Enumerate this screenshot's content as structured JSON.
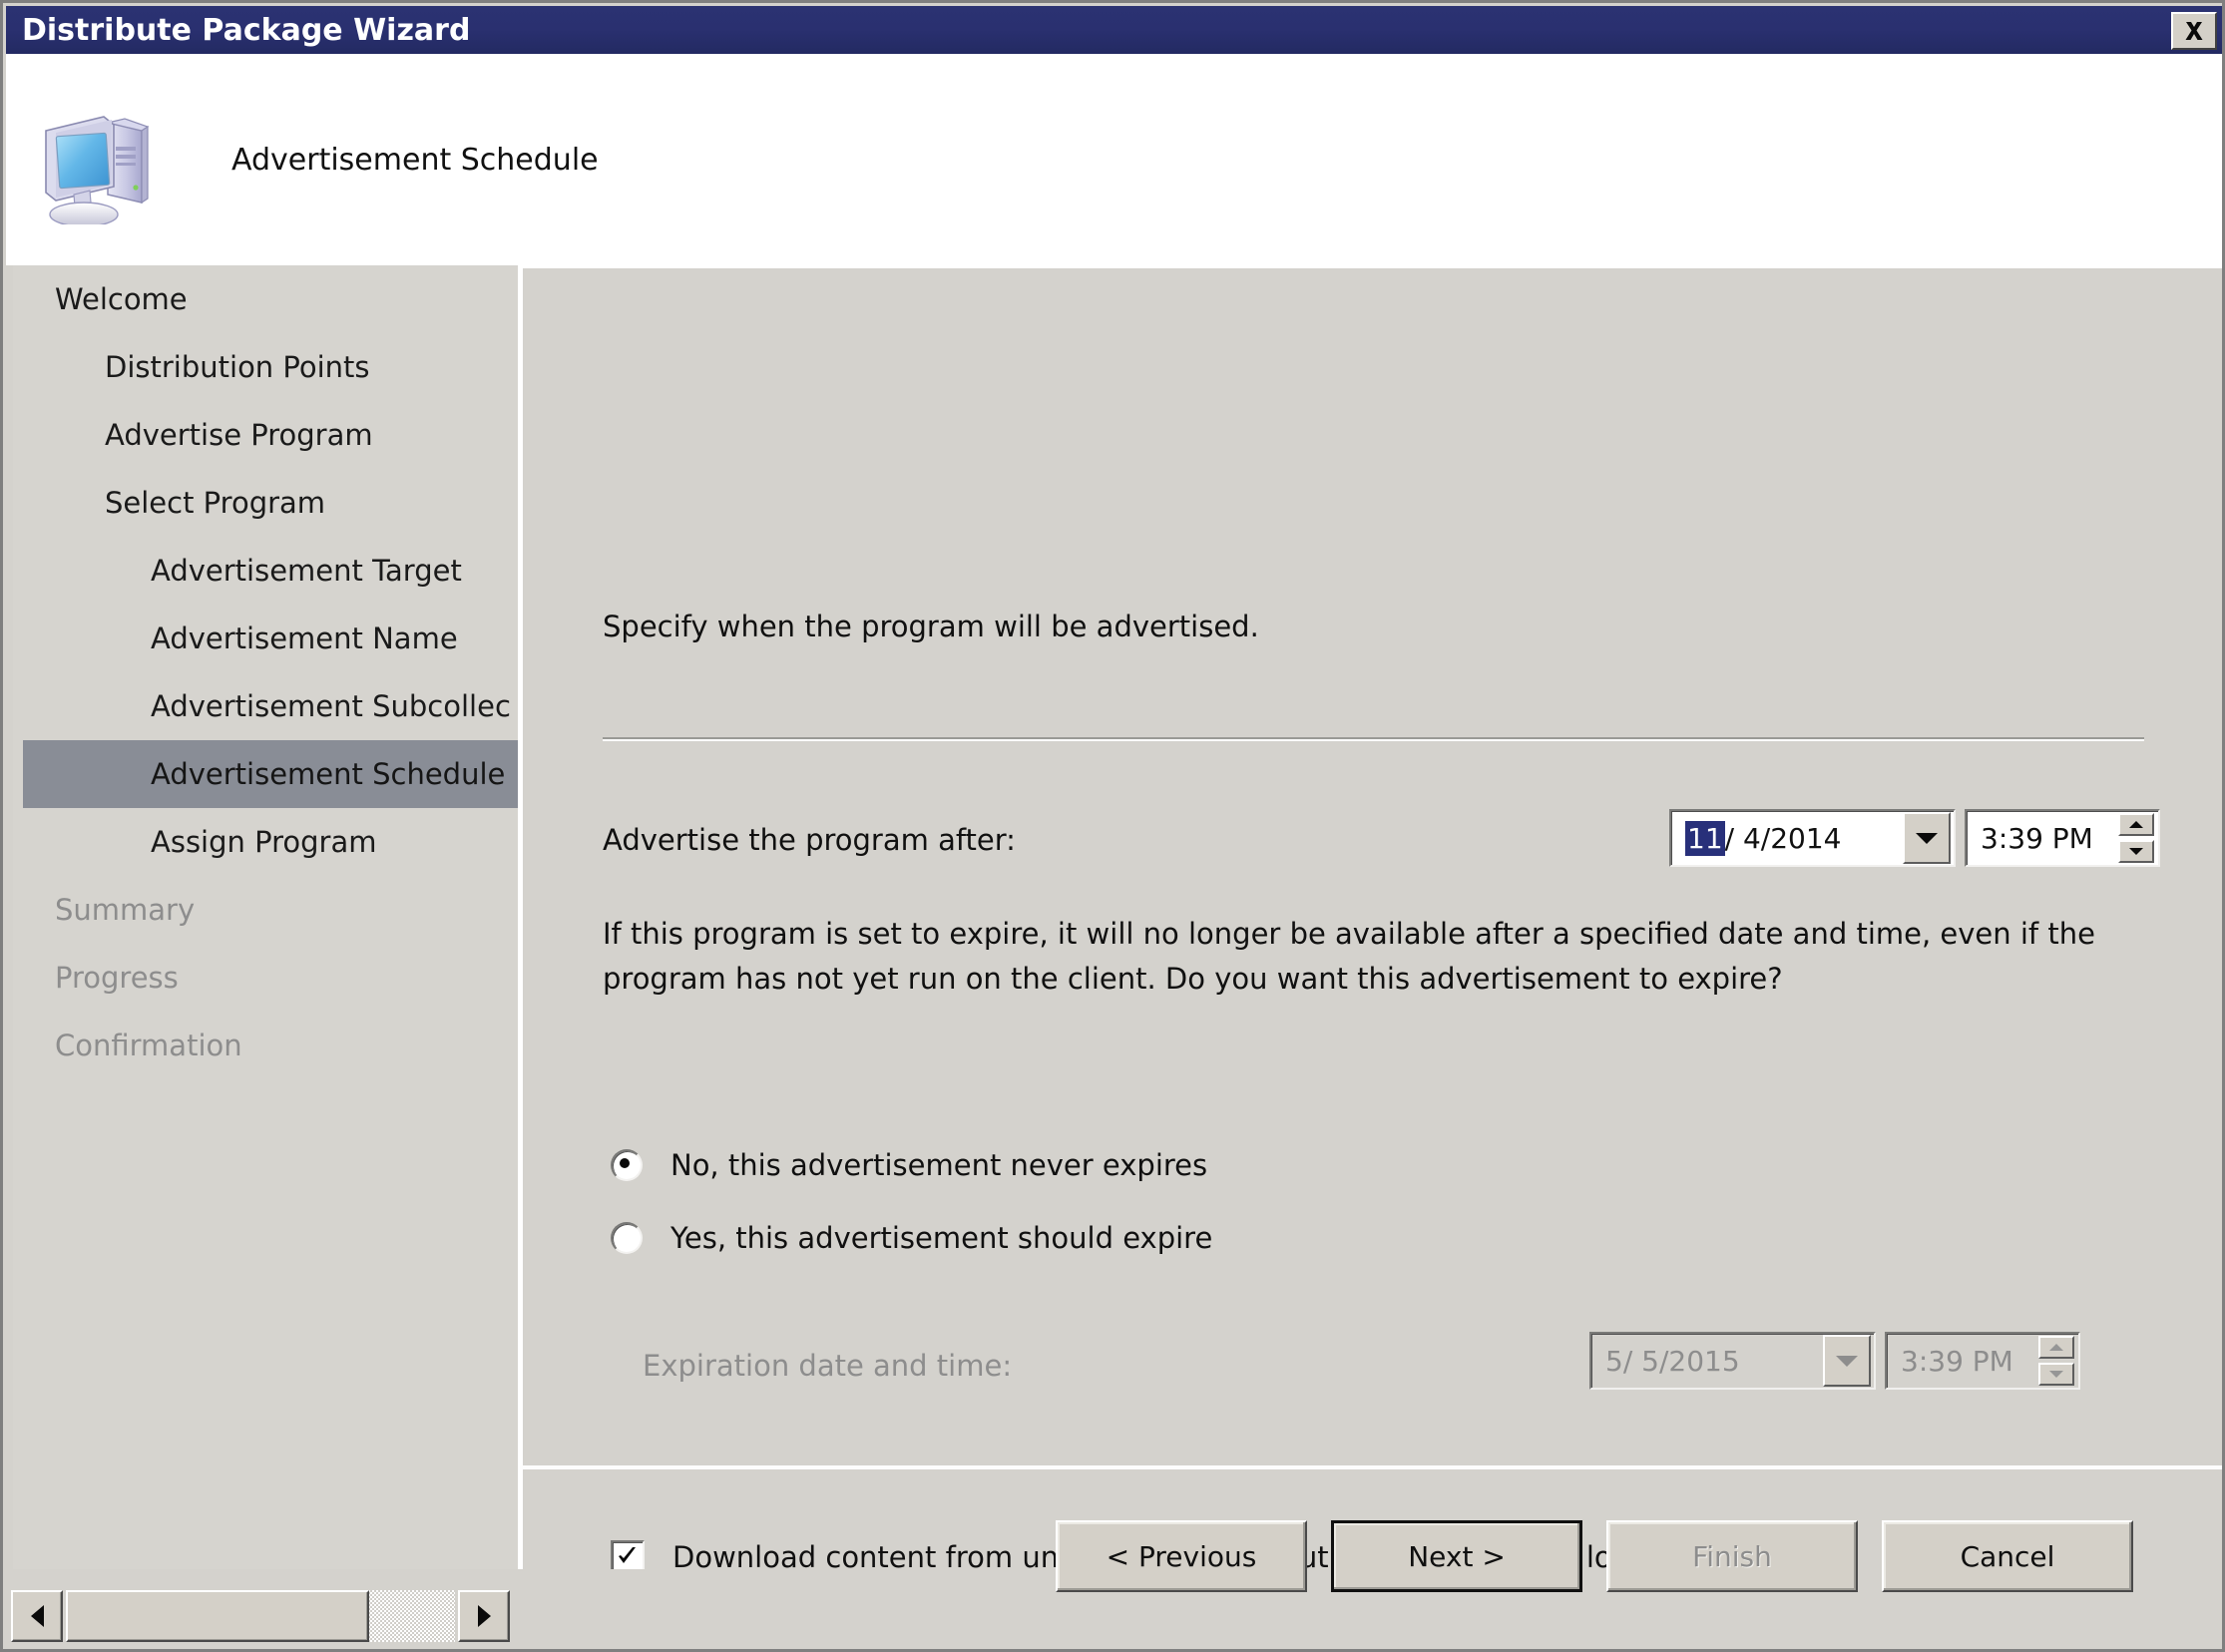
{
  "window": {
    "title": "Distribute Package Wizard",
    "close_icon": "close-x-icon"
  },
  "header": {
    "title": "Advertisement Schedule",
    "icon": "computer-icon"
  },
  "sidebar": {
    "items": [
      {
        "label": "Welcome",
        "level": 0,
        "selected": false,
        "disabled": false
      },
      {
        "label": "Distribution Points",
        "level": 1,
        "selected": false,
        "disabled": false
      },
      {
        "label": "Advertise Program",
        "level": 1,
        "selected": false,
        "disabled": false
      },
      {
        "label": "Select Program",
        "level": 1,
        "selected": false,
        "disabled": false
      },
      {
        "label": "Advertisement Target",
        "level": 2,
        "selected": false,
        "disabled": false
      },
      {
        "label": "Advertisement Name",
        "level": 2,
        "selected": false,
        "disabled": false
      },
      {
        "label": "Advertisement Subcollec",
        "level": 2,
        "selected": false,
        "disabled": false
      },
      {
        "label": "Advertisement Schedule",
        "level": 2,
        "selected": true,
        "disabled": false
      },
      {
        "label": "Assign Program",
        "level": 2,
        "selected": false,
        "disabled": false
      },
      {
        "label": "Summary",
        "level": 0,
        "selected": false,
        "disabled": true
      },
      {
        "label": "Progress",
        "level": 0,
        "selected": false,
        "disabled": true
      },
      {
        "label": "Confirmation",
        "level": 0,
        "selected": false,
        "disabled": true
      }
    ]
  },
  "content": {
    "intro": "Specify when the program will be advertised.",
    "advertise_after_label": "Advertise the program after:",
    "advertise_after_date_selected": "11",
    "advertise_after_date_rest": "/  4/2014",
    "advertise_after_time": "3:39 PM",
    "expire_paragraph": "If this program is set to expire, it will no longer be available after a specified date and time, even if the program has not yet run on the client. Do you want this advertisement to expire?",
    "radio_no_label": "No, this advertisement never expires",
    "radio_yes_label": "Yes, this advertisement should expire",
    "expiration_label": "Expiration date and time:",
    "expiration_date": "5/  5/2015",
    "expiration_time": "3:39 PM",
    "download_checkbox_label": "Download content from unprotected distribution point and run locally",
    "download_checkbox_checked": true,
    "radio_no_selected": true,
    "radio_yes_selected": false
  },
  "footer": {
    "previous_label": "< Previous",
    "next_label": "Next >",
    "finish_label": "Finish",
    "cancel_label": "Cancel"
  },
  "colors": {
    "titlebar": "#2b3272",
    "selection": "#28307a",
    "nav_highlight": "#898d96",
    "face": "#d4d2cd",
    "disabled_text": "#8d8d8d"
  }
}
